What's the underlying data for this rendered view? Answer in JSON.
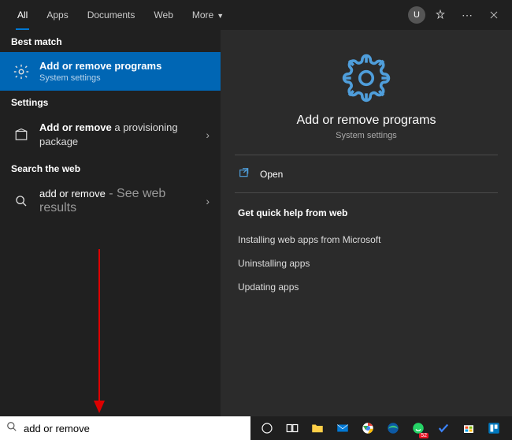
{
  "tabs": {
    "all": "All",
    "apps": "Apps",
    "documents": "Documents",
    "web": "Web",
    "more": "More"
  },
  "user": {
    "initial": "U"
  },
  "left": {
    "bestMatch": "Best match",
    "settings": "Settings",
    "searchWeb": "Search the web",
    "best": {
      "title": "Add or remove programs",
      "subtitle": "System settings"
    },
    "setting1_prefix": "Add or remove",
    "setting1_suffix": " a provisioning package",
    "web1_prefix": "add or remove",
    "web1_suffix": " - See web results"
  },
  "preview": {
    "title": "Add or remove programs",
    "subtitle": "System settings",
    "open": "Open",
    "helpTitle": "Get quick help from web",
    "help1": "Installing web apps from Microsoft",
    "help2": "Uninstalling apps",
    "help3": "Updating apps"
  },
  "search": {
    "value": "add or remove"
  },
  "taskbar": {
    "badge": "52"
  }
}
